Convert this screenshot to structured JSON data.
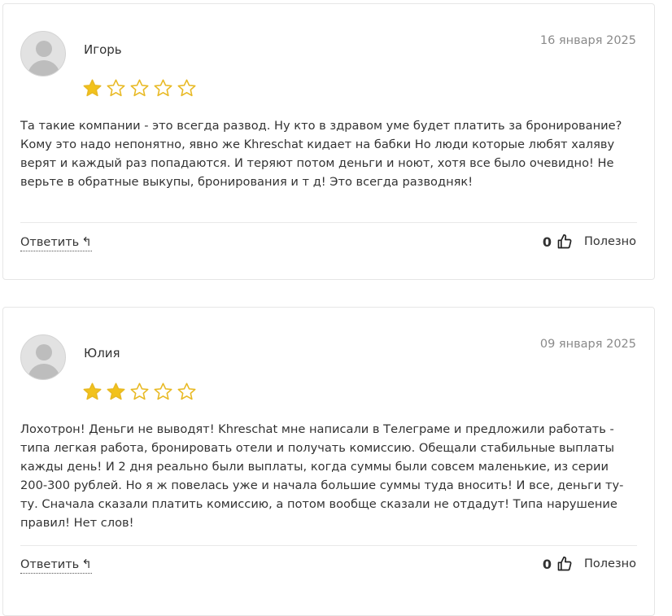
{
  "reviews": [
    {
      "author": "Игорь",
      "date": "16 января 2025",
      "rating": 1,
      "max_rating": 5,
      "text": "Та такие компании - это всегда развод. Ну кто в здравом уме будет платить за бронирование? Кому это надо непонятно, явно же Khreschat кидает на бабки Но люди которые любят халяву верят и каждый раз попадаются. И теряют потом деньги и ноют, хотя все было очевидно! Не верьте в обратные выкупы, бронирования и т д! Это всегда разводняк!",
      "reply_label": "Ответить",
      "helpful_count": "0",
      "helpful_label": "Полезно"
    },
    {
      "author": "Юлия",
      "date": "09 января 2025",
      "rating": 2,
      "max_rating": 5,
      "text": "Лохотрон! Деньги не выводят! Khreschat мне написали в Телеграме и предложили работать - типа легкая работа, бронировать отели и получать комиссию. Обещали стабильные выплаты кажды день! И 2 дня реально были выплаты, когда суммы были совсем маленькие, из серии 200-300 рублей. Но я ж повелась уже и начала большие суммы туда вносить! И все, деньги ту-ту. Сначала сказали платить комиссию, а потом вообще сказали не отдадут! Типа нарушение правил! Нет слов!",
      "reply_label": "Ответить",
      "helpful_count": "0",
      "helpful_label": "Полезно"
    }
  ],
  "icons": {
    "avatar": "user-avatar-placeholder",
    "star": "star-icon",
    "reply": "reply-arrow-icon",
    "helpful": "thumbs-up-icon"
  },
  "colors": {
    "star_filled": "#f2c21b",
    "star_outline": "#e8b923",
    "date": "#8a8a8a",
    "text": "#333333"
  }
}
